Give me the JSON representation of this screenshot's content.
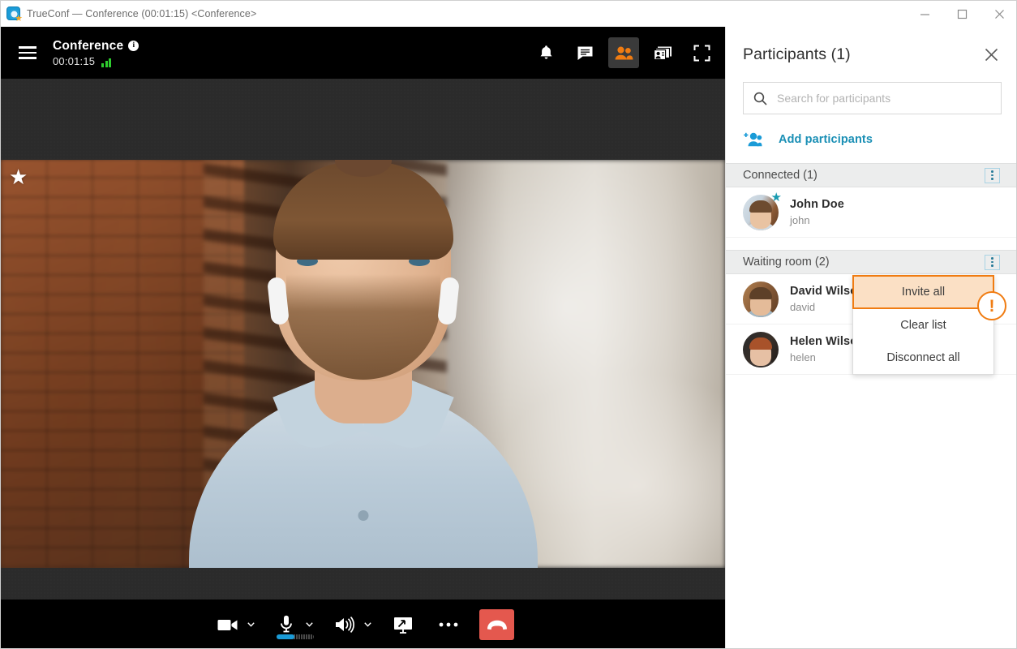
{
  "window": {
    "title": "TrueConf — Conference (00:01:15) <Conference>",
    "app_icon": "trueconf-logo-icon",
    "minimize_label": "Minimize",
    "maximize_label": "Maximize",
    "close_label": "Close"
  },
  "conference": {
    "menu_icon": "hamburger-menu-icon",
    "title": "Conference",
    "info_icon": "info-icon",
    "timer": "00:01:15",
    "signal_icon": "signal-strength-icon",
    "header_actions": [
      {
        "name": "notifications-button",
        "icon": "bell-icon",
        "active": false
      },
      {
        "name": "chat-button",
        "icon": "chat-bubble-icon",
        "active": false
      },
      {
        "name": "participants-button",
        "icon": "people-icon",
        "active": true
      },
      {
        "name": "layout-button",
        "icon": "video-layout-icon",
        "active": false
      },
      {
        "name": "fullscreen-button",
        "icon": "fullscreen-icon",
        "active": false
      }
    ],
    "favorite_star_icon": "star-icon"
  },
  "toolbar": {
    "camera": {
      "icon": "camera-icon",
      "caret": "⌄"
    },
    "microphone": {
      "icon": "microphone-icon",
      "caret": "⌄",
      "volume_percent": 48
    },
    "speaker": {
      "icon": "speaker-icon",
      "caret": "⌄"
    },
    "screen_share": {
      "icon": "screen-share-icon"
    },
    "more": {
      "icon": "more-dots-icon"
    },
    "hangup": {
      "icon": "hangup-phone-icon",
      "color": "#e4584e"
    }
  },
  "panel": {
    "title": "Participants (1)",
    "close_icon": "close-icon",
    "search": {
      "icon": "search-icon",
      "placeholder": "Search for participants",
      "value": ""
    },
    "add_participants": {
      "icon": "add-people-icon",
      "label": "Add participants"
    },
    "sections": [
      {
        "name": "connected",
        "title": "Connected (1)",
        "menu_icon": "kebab-menu-icon",
        "participants": [
          {
            "name": "John Doe",
            "login": "john",
            "owner": true,
            "star_icon": "star-icon"
          }
        ]
      },
      {
        "name": "waiting-room",
        "title": "Waiting room (2)",
        "menu_icon": "kebab-menu-icon",
        "participants": [
          {
            "name": "David Wilson",
            "login": "david",
            "owner": false
          },
          {
            "name": "Helen Wilson",
            "login": "helen",
            "owner": false
          }
        ]
      }
    ]
  },
  "context_menu": {
    "items": [
      {
        "label": "Invite all",
        "highlighted": true
      },
      {
        "label": "Clear list",
        "highlighted": false
      },
      {
        "label": "Disconnect all",
        "highlighted": false
      }
    ],
    "badge": "!"
  },
  "colors": {
    "accent_orange": "#f07c12",
    "highlight_bg": "#fbe0c5",
    "teal": "#1a9bd7",
    "link_teal": "#1a8fb5",
    "hangup_red": "#e4584e",
    "section_bg": "#eceded",
    "signal_green": "#2ecc2e"
  }
}
